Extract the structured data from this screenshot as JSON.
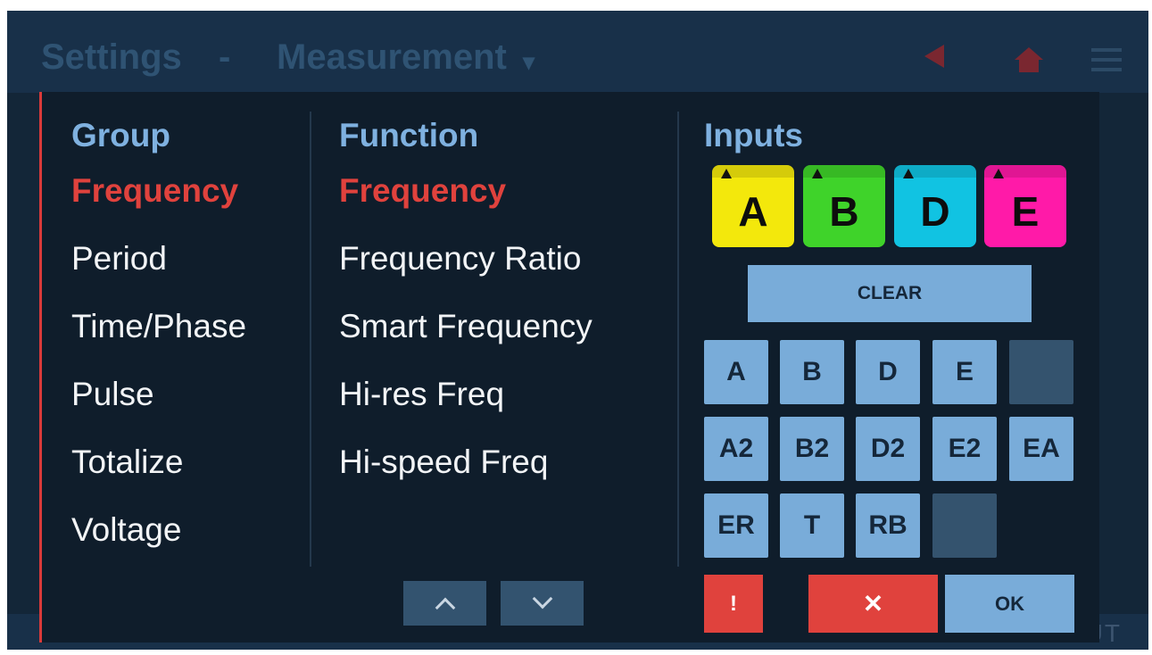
{
  "header": {
    "breadcrumb": [
      "Settings",
      "-",
      "Measurement"
    ],
    "dropdown_caret": "▾",
    "icons": [
      "back-icon",
      "home-icon",
      "menu-icon"
    ]
  },
  "footer": {
    "partial_label": "ABOUT"
  },
  "group": {
    "title": "Group",
    "items": [
      "Frequency",
      "Period",
      "Time/Phase",
      "Pulse",
      "Totalize",
      "Voltage"
    ],
    "selected": "Frequency"
  },
  "function": {
    "title": "Function",
    "items": [
      "Frequency",
      "Frequency Ratio",
      "Smart Frequency",
      "Hi-res Freq",
      "Hi-speed Freq"
    ],
    "selected": "Frequency"
  },
  "inputs": {
    "title": "Inputs",
    "channels": [
      {
        "label": "A",
        "color": "#f3e80c"
      },
      {
        "label": "B",
        "color": "#3fd32a"
      },
      {
        "label": "D",
        "color": "#11c3e2"
      },
      {
        "label": "E",
        "color": "#ff1aa8"
      }
    ],
    "clear_label": "CLEAR",
    "keys": [
      [
        "A",
        "B",
        "D",
        "E",
        ""
      ],
      [
        "A2",
        "B2",
        "D2",
        "E2",
        "EA"
      ],
      [
        "ER",
        "T",
        "RB",
        ""
      ]
    ]
  },
  "actions": {
    "warning_label": "!",
    "cancel_label": "✕",
    "ok_label": "OK"
  },
  "colors": {
    "accent_red": "#e0423d",
    "title_blue": "#7fb1e0",
    "key_blue": "#79acd9",
    "background": "#0f1d2b"
  }
}
